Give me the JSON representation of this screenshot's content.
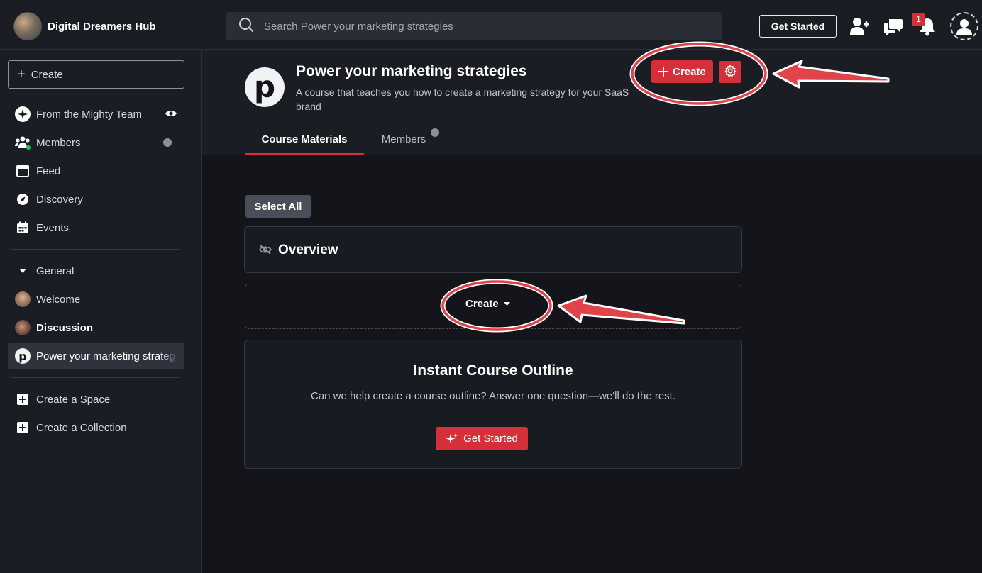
{
  "topbar": {
    "brand_name": "Digital Dreamers Hub",
    "search_placeholder": "Search Power your marketing strategies",
    "get_started_label": "Get Started",
    "notification_count": "1",
    "icons": [
      "add-person-icon",
      "chat-icon",
      "bell-icon",
      "user-avatar-icon"
    ]
  },
  "sidebar": {
    "create_label": "Create",
    "items": [
      {
        "label": "From the Mighty Team",
        "icon": "sparkle-icon"
      },
      {
        "label": "Members",
        "icon": "people-icon"
      },
      {
        "label": "Feed",
        "icon": "feed-icon"
      },
      {
        "label": "Discovery",
        "icon": "compass-icon"
      },
      {
        "label": "Events",
        "icon": "calendar-icon"
      }
    ],
    "section_label": "General",
    "spaces": [
      {
        "label": "Welcome"
      },
      {
        "label": "Discussion"
      },
      {
        "label": "Power your marketing strategies"
      }
    ],
    "actions": [
      {
        "label": "Create a Space"
      },
      {
        "label": "Create a Collection"
      }
    ]
  },
  "course": {
    "logo_letter": "p",
    "title": "Power your marketing strategies",
    "description": "A course that teaches you how to create a marketing strategy for your SaaS brand",
    "create_label": "Create",
    "tabs": [
      {
        "label": "Course Materials",
        "active": true
      },
      {
        "label": "Members",
        "active": false
      }
    ]
  },
  "content": {
    "select_all_label": "Select All",
    "overview_title": "Overview",
    "create_dropdown_label": "Create",
    "outline": {
      "title": "Instant Course Outline",
      "description": "Can we help create a course outline? Answer one question—we'll do the rest.",
      "button_label": "Get Started"
    }
  },
  "colors": {
    "accent": "#d5303a",
    "background": "#14151a",
    "panel": "#1b1d24",
    "annotation": "#e0444a"
  }
}
